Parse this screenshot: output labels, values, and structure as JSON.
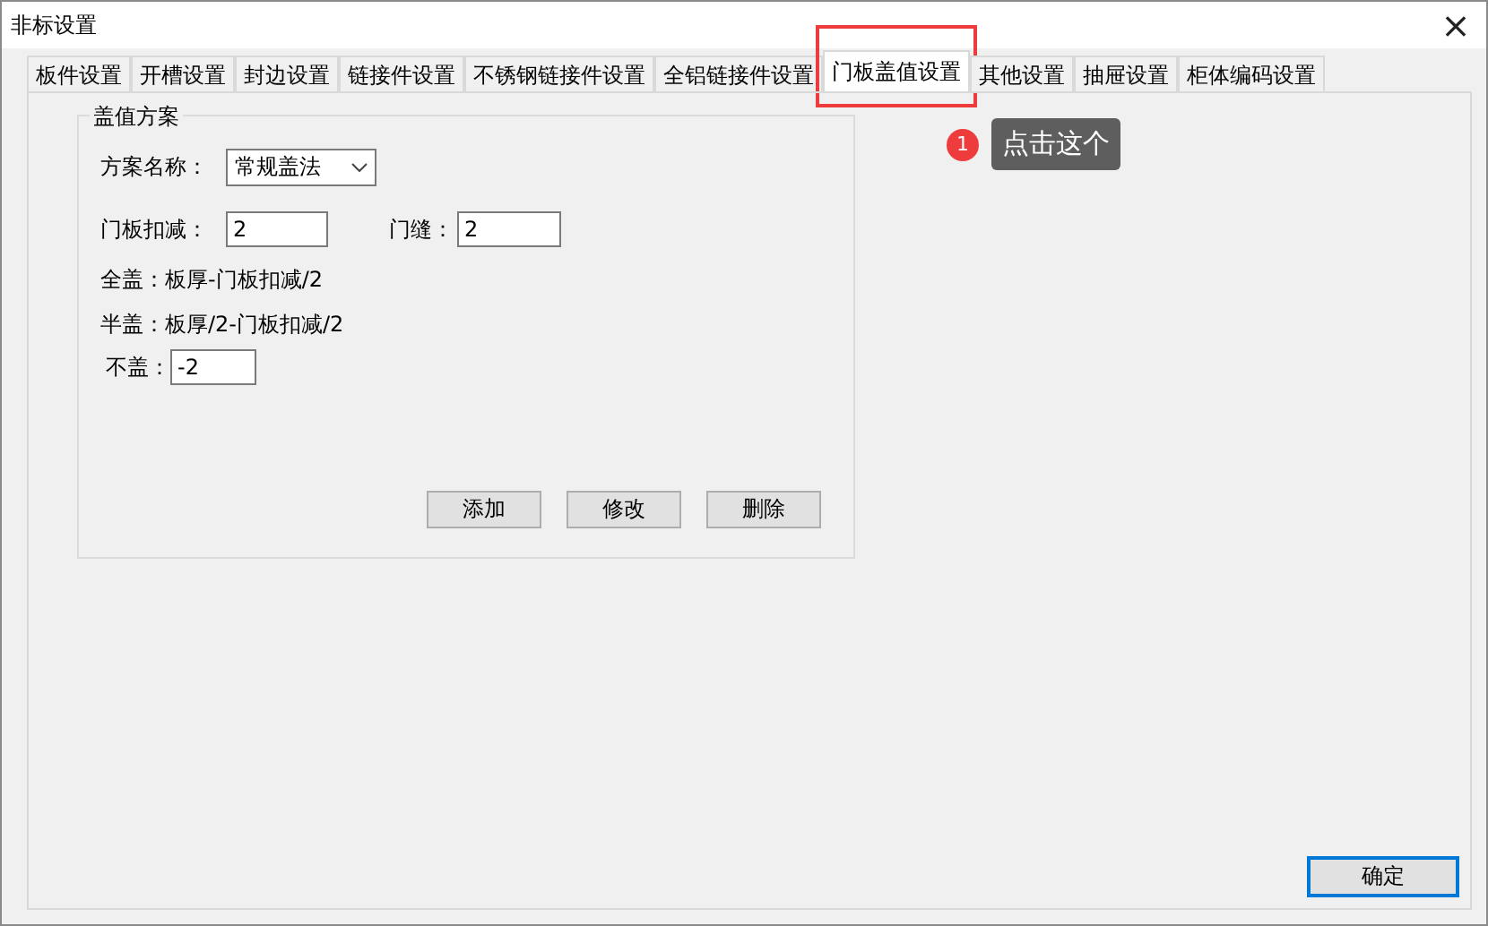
{
  "window": {
    "title": "非标设置",
    "close": "×"
  },
  "tabs": [
    {
      "label": "板件设置",
      "selected": false
    },
    {
      "label": "开槽设置",
      "selected": false
    },
    {
      "label": "封边设置",
      "selected": false
    },
    {
      "label": "链接件设置",
      "selected": false
    },
    {
      "label": "不锈钢链接件设置",
      "selected": false
    },
    {
      "label": "全铝链接件设置",
      "selected": false
    },
    {
      "label": "门板盖值设置",
      "selected": true
    },
    {
      "label": "其他设置",
      "selected": false
    },
    {
      "label": "抽屉设置",
      "selected": false
    },
    {
      "label": "柜体编码设置",
      "selected": false
    }
  ],
  "annotation": {
    "badge": "1",
    "text": "点击这个"
  },
  "group": {
    "title": "盖值方案",
    "scheme": {
      "label": "方案名称：",
      "value": "常规盖法"
    },
    "deduct": {
      "label": "门板扣减：",
      "value": "2"
    },
    "gap": {
      "label": "门缝：",
      "value": "2"
    },
    "full_cover": "全盖：板厚-门板扣减/2",
    "half_cover": "半盖：板厚/2-门板扣减/2",
    "no_cover": {
      "label": "不盖：",
      "value": "-2"
    },
    "buttons": [
      "添加",
      "修改",
      "删除"
    ]
  },
  "ok_button": "确定"
}
